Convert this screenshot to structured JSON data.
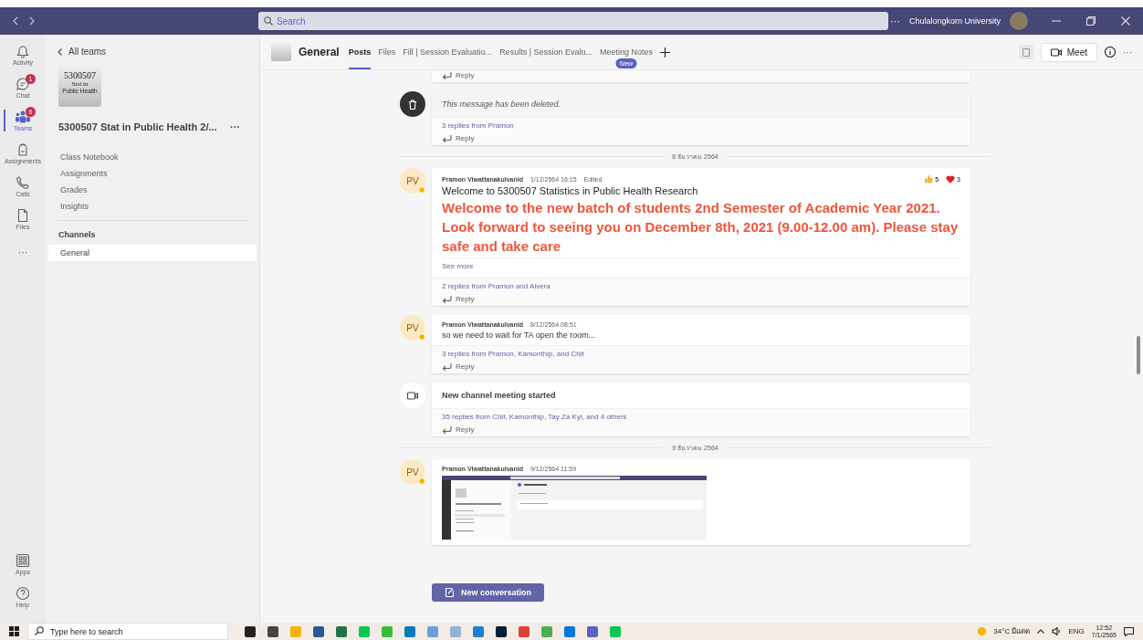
{
  "titlebar": {
    "search": {
      "placeholder": "Search"
    },
    "more": "···",
    "org": "Chulalongkorn University"
  },
  "rail": [
    {
      "kind": "activity",
      "label": "Activity",
      "selected": false
    },
    {
      "kind": "chat",
      "label": "Chat",
      "badge": "1",
      "selected": false
    },
    {
      "kind": "teams",
      "label": "Teams",
      "badge": "6",
      "selected": true
    },
    {
      "kind": "assignments",
      "label": "Assignments",
      "selected": false
    },
    {
      "kind": "calls",
      "label": "Calls",
      "selected": false
    },
    {
      "kind": "files",
      "label": "Files",
      "selected": false
    },
    {
      "kind": "more",
      "label": "···",
      "selected": false
    }
  ],
  "rail_bottom": [
    {
      "kind": "apps",
      "label": "Apps",
      "selected": false
    },
    {
      "kind": "help",
      "label": "Help",
      "selected": false
    }
  ],
  "sidebar": {
    "back": "All teams",
    "tile": [
      "5300507",
      "Stat in",
      "Public Health"
    ],
    "team_name": "5300507 Stat in Public Health 2/...",
    "more": "···",
    "items": [
      {
        "label": "Class Notebook",
        "selected": false
      },
      {
        "label": "Assignments",
        "selected": false
      },
      {
        "label": "Grades",
        "selected": false
      },
      {
        "label": "Insights",
        "selected": false
      }
    ],
    "channels_heading": "Channels",
    "channels": [
      {
        "label": "General",
        "selected": true
      }
    ]
  },
  "header": {
    "channel": "General",
    "tabs": [
      {
        "label": "Posts",
        "selected": true
      },
      {
        "label": "Files",
        "selected": false
      },
      {
        "label": "Fill | Session Evaluatio...",
        "selected": false
      },
      {
        "label": "Results | Session Evalu...",
        "selected": false
      },
      {
        "label": "Meeting Notes",
        "badge": "New",
        "selected": false
      }
    ],
    "meet": "Meet",
    "more": "···"
  },
  "posts": [
    {
      "kind": "tail",
      "reply": "Reply"
    },
    {
      "kind": "deleted",
      "text": "This message has been deleted.",
      "replies": "3 replies from Pramon",
      "reply": "Reply"
    },
    {
      "kind": "date",
      "text": "8 ธันวาคม 2564"
    },
    {
      "kind": "message",
      "avatar": "PV",
      "author": "Pramon Viwattanakulvanid",
      "time": "1/12/2564 16:15",
      "edited": "Edited",
      "subject": "Welcome to 5300507 Statistics in Public Health Research",
      "body": "Welcome to the new batch of students 2nd Semester of Academic Year 2021. Look forward to seeing you on December 8th, 2021 (9.00-12.00 am). Please stay safe and take care",
      "see_more": "See more",
      "reactions": [
        {
          "kind": "like",
          "count": "5"
        },
        {
          "kind": "heart",
          "count": "3"
        }
      ],
      "replies": "2 replies from Pramon and Alvera",
      "reply": "Reply"
    },
    {
      "kind": "message",
      "avatar": "PV",
      "author": "Pramon Viwattanakulvanid",
      "time": "8/12/2564 08:51",
      "text": "so we need to wait for TA open the room...",
      "replies": "3 replies from Pramon, Kamonthip, and Chit",
      "reply": "Reply"
    },
    {
      "kind": "meeting",
      "title": "New channel meeting started",
      "replies": "35 replies from Chit, Kamonthip, Tay Za Kyi, and 4 others",
      "reply": "Reply"
    },
    {
      "kind": "date",
      "text": "9 ธันวาคม 2564"
    },
    {
      "kind": "image",
      "avatar": "PV",
      "author": "Pramon Viwattanakulvanid",
      "time": "9/12/2564 11:59"
    }
  ],
  "new_conversation": "New conversation",
  "taskbar": {
    "search": {
      "placeholder": "Type here to search"
    },
    "weather": "34°C มีแดด",
    "lang": "ENG",
    "time": "12:52",
    "date": "7/1/2565"
  }
}
